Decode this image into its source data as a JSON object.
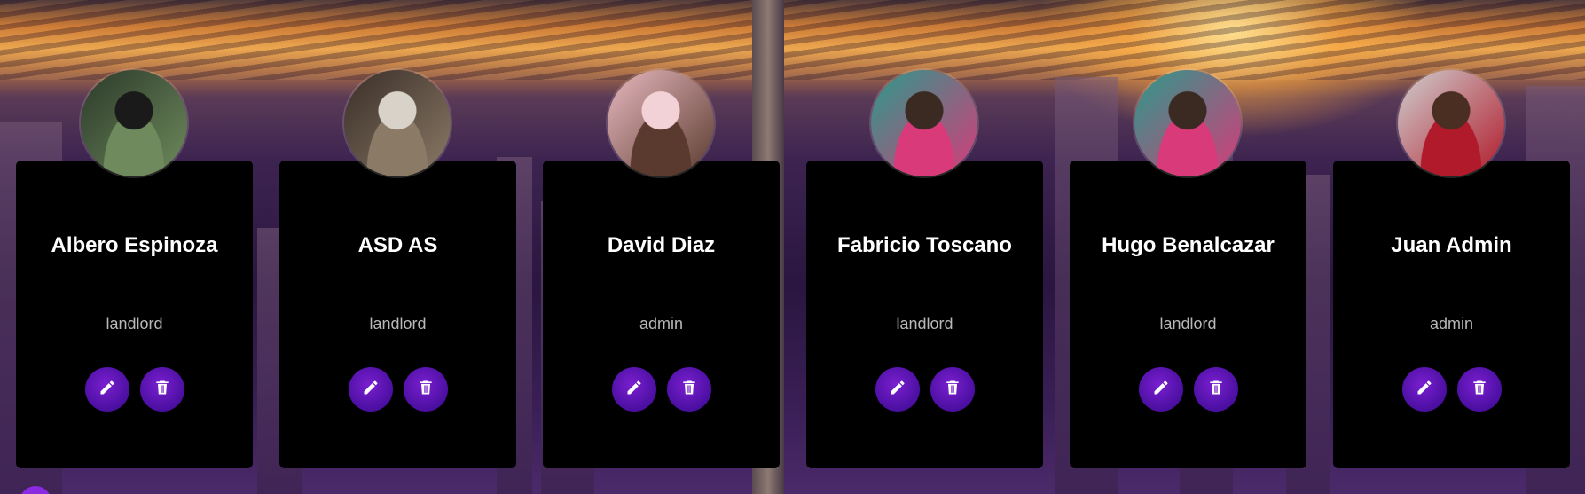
{
  "users": [
    {
      "name": "Albero Espinoza",
      "role": "landlord",
      "avatar": "person-dark-curly-hair",
      "avatar_colors": [
        "#2b3a2a",
        "#6f8a5c",
        "#1a1a1a"
      ]
    },
    {
      "name": "ASD AS",
      "role": "landlord",
      "avatar": "living-room-interior",
      "avatar_colors": [
        "#3a2e28",
        "#8a7a66",
        "#d8d2c8"
      ]
    },
    {
      "name": "David Diaz",
      "role": "admin",
      "avatar": "person-afro-hair-pink",
      "avatar_colors": [
        "#e8b9c0",
        "#5a3a2e",
        "#f2d2d6"
      ]
    },
    {
      "name": "Fabricio Toscano",
      "role": "landlord",
      "avatar": "person-colorful-shirt",
      "avatar_colors": [
        "#2a9a8a",
        "#d83a7a",
        "#3a2a22"
      ]
    },
    {
      "name": "Hugo Benalcazar",
      "role": "landlord",
      "avatar": "person-colorful-shirt",
      "avatar_colors": [
        "#2a9a8a",
        "#d83a7a",
        "#3a2a22"
      ]
    },
    {
      "name": "Juan Admin",
      "role": "admin",
      "avatar": "person-red-sweater-smiling",
      "avatar_colors": [
        "#cfcfcf",
        "#b01a2a",
        "#4a2e22"
      ]
    }
  ],
  "actions": {
    "edit_icon": "pencil-icon",
    "delete_icon": "trash-icon"
  },
  "colors": {
    "card_bg": "#000000",
    "button": "#5a15b8",
    "name": "#ffffff",
    "role": "#b8b8b8"
  }
}
